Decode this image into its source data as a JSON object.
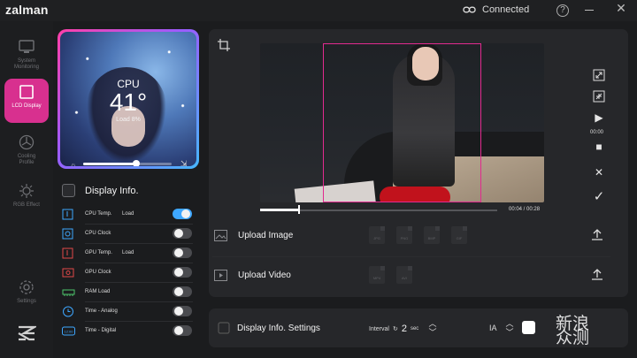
{
  "app": {
    "logo": "zalman",
    "connection": "Connected"
  },
  "nav": [
    {
      "label": "System\nMonitoring"
    },
    {
      "label": "LCD Display"
    },
    {
      "label": "Cooling\nProfile"
    },
    {
      "label": "RGB Effect"
    },
    {
      "label": "Settings"
    }
  ],
  "preview": {
    "label": "CPU",
    "value": "41°",
    "sub": "Load  8%"
  },
  "display_info": {
    "title": "Display Info.",
    "rows": [
      {
        "label": "CPU Temp.",
        "sub": "Load",
        "on": true
      },
      {
        "label": "CPU Clock",
        "sub": "",
        "on": false
      },
      {
        "label": "GPU Temp.",
        "sub": "Load",
        "on": false
      },
      {
        "label": "GPU Clock",
        "sub": "",
        "on": false
      },
      {
        "label": "RAM Load",
        "sub": "",
        "on": false
      },
      {
        "label": "Time - Analog",
        "sub": "",
        "on": false
      },
      {
        "label": "Time - Digital",
        "sub": "",
        "on": false
      }
    ]
  },
  "video": {
    "time": "00:04 / 00:28",
    "progress": 0.16,
    "side_time": "00:00"
  },
  "upload": {
    "image": {
      "label": "Upload Image",
      "formats": [
        "JPG",
        "PNG",
        "BMP",
        "GIF"
      ]
    },
    "video": {
      "label": "Upload Video",
      "formats": [
        "MP4",
        "AVI"
      ]
    }
  },
  "settings": {
    "title": "Display Info. Settings",
    "interval_label": "Interval",
    "interval_value": "2",
    "interval_unit": "sec",
    "font_label": "IA",
    "color": "#ffffff"
  },
  "watermark": "新浪\n众测",
  "colors": {
    "accent": "#d8308f",
    "toggle_on": "#3ea7ff",
    "crop": "#e22a8f"
  }
}
